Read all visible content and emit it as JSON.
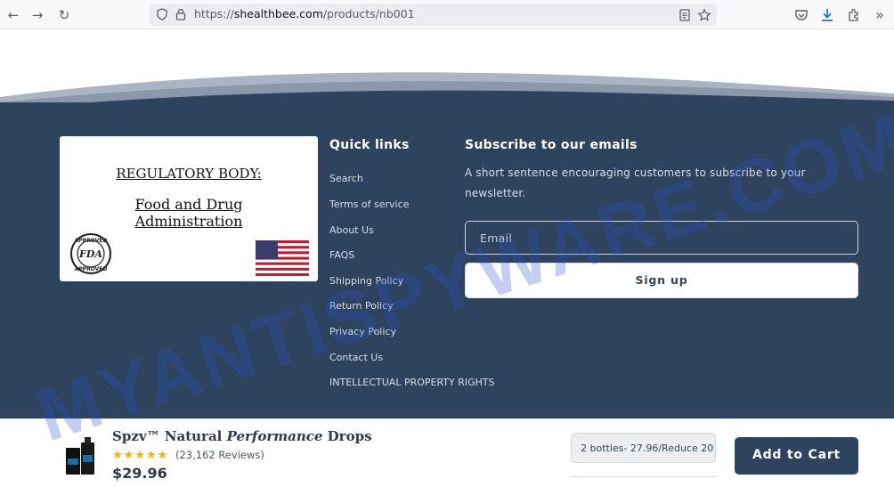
{
  "browser": {
    "url_prefix": "https://",
    "url_domain": "shealthbee.com",
    "url_path": "/products/nb001"
  },
  "certificate": {
    "title": "REGULATORY BODY:",
    "line1": "Food and Drug",
    "line2": "Administration",
    "seal_text_top": "APPROVED",
    "seal_text_center": "FDA",
    "seal_text_bottom": "APPROVED"
  },
  "quick_links": {
    "heading": "Quick links",
    "items": [
      "Search",
      "Terms of service",
      "About Us",
      "FAQS",
      "Shipping Policy",
      "Return Policy",
      "Privacy Policy",
      "Contact Us",
      "INTELLECTUAL PROPERTY RIGHTS"
    ]
  },
  "subscribe": {
    "heading": "Subscribe to our emails",
    "text_line1": "A short sentence encouraging customers to subscribe to your",
    "text_line2": "newsletter.",
    "email_placeholder": "Email",
    "signup_label": "Sign up"
  },
  "watermark": "MYANTISPYWARE.COM",
  "product_bar": {
    "name_prefix": "Spzv™ Natural ",
    "name_italic": "Performance",
    "name_suffix": " Drops",
    "stars": "★★★★★",
    "rating": 5,
    "reviews": "(23,162 Reviews)",
    "price": "$29.96",
    "variant": "2 bottles- 27.96/Reduce 20",
    "add_to_cart": "Add to Cart"
  },
  "colors": {
    "footer_bg": "#2e445e",
    "button_primary": "#2e445e",
    "star": "#f5b301",
    "watermark": "#2850c8"
  }
}
